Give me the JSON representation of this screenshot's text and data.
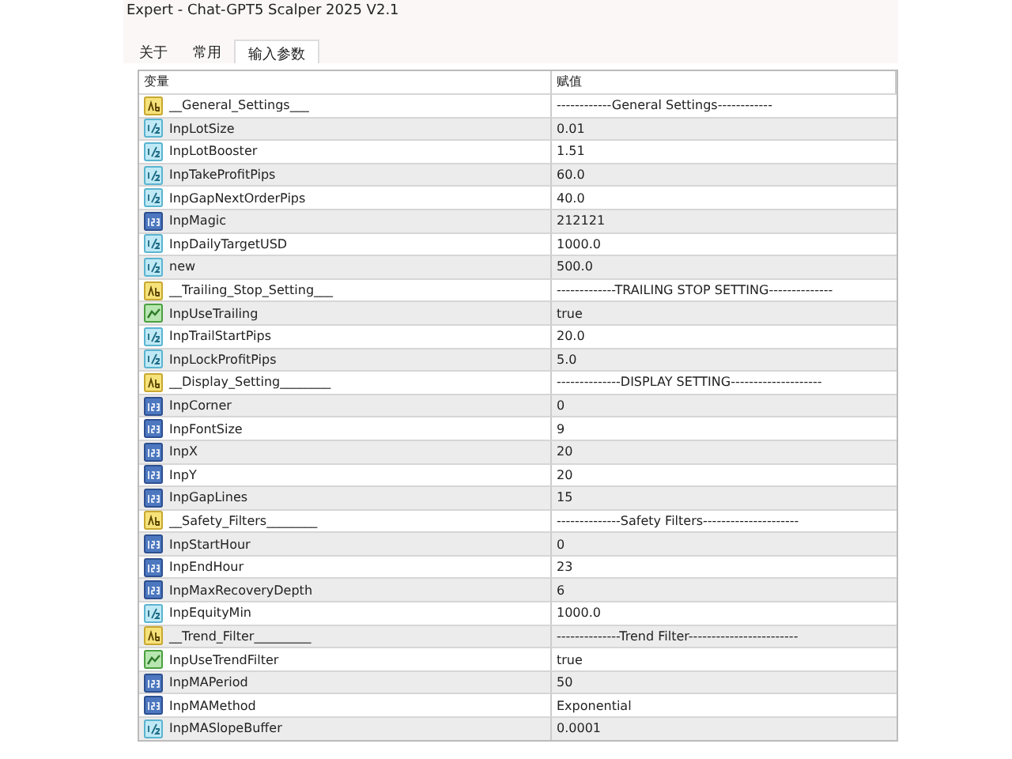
{
  "window": {
    "title": "Expert - Chat-GPT5 Scalper 2025 V2.1"
  },
  "tabs": [
    {
      "label": "关于",
      "selected": false
    },
    {
      "label": "常用",
      "selected": false
    },
    {
      "label": "输入参数",
      "selected": true
    }
  ],
  "table": {
    "columns": [
      "变量",
      "赋值"
    ],
    "rows": [
      {
        "kind": "string",
        "name": "__General_Settings___",
        "value": "------------General Settings------------"
      },
      {
        "kind": "double",
        "name": "InpLotSize",
        "value": "0.01"
      },
      {
        "kind": "double",
        "name": "InpLotBooster",
        "value": "1.51"
      },
      {
        "kind": "double",
        "name": "InpTakeProfitPips",
        "value": "60.0"
      },
      {
        "kind": "double",
        "name": "InpGapNextOrderPips",
        "value": "40.0"
      },
      {
        "kind": "int",
        "name": "InpMagic",
        "value": "212121"
      },
      {
        "kind": "double",
        "name": "InpDailyTargetUSD",
        "value": "1000.0"
      },
      {
        "kind": "double",
        "name": "new",
        "value": "500.0"
      },
      {
        "kind": "string",
        "name": "__Trailing_Stop_Setting___",
        "value": "-------------TRAILING STOP SETTING--------------"
      },
      {
        "kind": "bool",
        "name": "InpUseTrailing",
        "value": "true"
      },
      {
        "kind": "double",
        "name": "InpTrailStartPips",
        "value": "20.0"
      },
      {
        "kind": "double",
        "name": "InpLockProfitPips",
        "value": "5.0"
      },
      {
        "kind": "string",
        "name": "__Display_Setting________",
        "value": "--------------DISPLAY SETTING--------------------"
      },
      {
        "kind": "int",
        "name": "InpCorner",
        "value": "0"
      },
      {
        "kind": "int",
        "name": "InpFontSize",
        "value": "9"
      },
      {
        "kind": "int",
        "name": "InpX",
        "value": "20"
      },
      {
        "kind": "int",
        "name": "InpY",
        "value": "20"
      },
      {
        "kind": "int",
        "name": "InpGapLines",
        "value": "15"
      },
      {
        "kind": "string",
        "name": "__Safety_Filters________",
        "value": "--------------Safety Filters---------------------"
      },
      {
        "kind": "int",
        "name": "InpStartHour",
        "value": "0"
      },
      {
        "kind": "int",
        "name": "InpEndHour",
        "value": "23"
      },
      {
        "kind": "int",
        "name": "InpMaxRecoveryDepth",
        "value": "6"
      },
      {
        "kind": "double",
        "name": "InpEquityMin",
        "value": "1000.0"
      },
      {
        "kind": "string",
        "name": "__Trend_Filter_________",
        "value": "--------------Trend Filter------------------------"
      },
      {
        "kind": "bool",
        "name": "InpUseTrendFilter",
        "value": "true"
      },
      {
        "kind": "int",
        "name": "InpMAPeriod",
        "value": "50"
      },
      {
        "kind": "int",
        "name": "InpMAMethod",
        "value": "Exponential"
      },
      {
        "kind": "double",
        "name": "InpMASlopeBuffer",
        "value": "0.0001"
      }
    ]
  }
}
